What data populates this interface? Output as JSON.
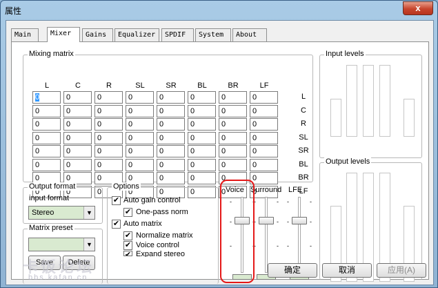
{
  "window": {
    "title": "属性",
    "close": "x"
  },
  "tabs": [
    "Main",
    "Mixer",
    "Gains",
    "Equalizer",
    "SPDIF",
    "System",
    "About"
  ],
  "mixing_matrix": {
    "legend": "Mixing matrix",
    "columns": [
      "L",
      "C",
      "R",
      "SL",
      "SR",
      "BL",
      "BR",
      "LF"
    ],
    "rows": [
      "L",
      "C",
      "R",
      "SL",
      "SR",
      "BL",
      "BR",
      "LF"
    ],
    "values": [
      [
        "0",
        "0",
        "0",
        "0",
        "0",
        "0",
        "0",
        "0"
      ],
      [
        "0",
        "0",
        "0",
        "0",
        "0",
        "0",
        "0",
        "0"
      ],
      [
        "0",
        "0",
        "0",
        "0",
        "0",
        "0",
        "0",
        "0"
      ],
      [
        "0",
        "0",
        "0",
        "0",
        "0",
        "0",
        "0",
        "0"
      ],
      [
        "0",
        "0",
        "0",
        "0",
        "0",
        "0",
        "0",
        "0"
      ],
      [
        "0",
        "0",
        "0",
        "0",
        "0",
        "0",
        "0",
        "0"
      ],
      [
        "0",
        "0",
        "0",
        "0",
        "0",
        "0",
        "0",
        "0"
      ],
      [
        "0",
        "0",
        "0",
        "0",
        "0",
        "0",
        "0",
        "0"
      ]
    ]
  },
  "input_levels": {
    "legend": "Input levels"
  },
  "output_levels": {
    "legend": "Output levels"
  },
  "output_format": {
    "legend": "Output format",
    "label": "input format",
    "value": "Stereo"
  },
  "matrix_preset": {
    "legend": "Matrix preset",
    "value": "",
    "save": "Save",
    "delete": "Delete"
  },
  "options": {
    "legend": "Options",
    "auto_gain": "Auto gain control",
    "one_pass": "One-pass norm",
    "auto_matrix": "Auto matrix",
    "normalize": "Normalize matrix",
    "voice_control": "Voice control",
    "expand_stereo": "Expand stereo"
  },
  "sliders": {
    "voice": "Voice",
    "surround": "Surround",
    "lfe": "LFE",
    "tick": "-"
  },
  "buttons": {
    "ok": "确定",
    "cancel": "取消",
    "apply": "应用(A)"
  },
  "watermark": {
    "main": "卡饭论坛",
    "sub": "bbs.kafan.cn"
  }
}
